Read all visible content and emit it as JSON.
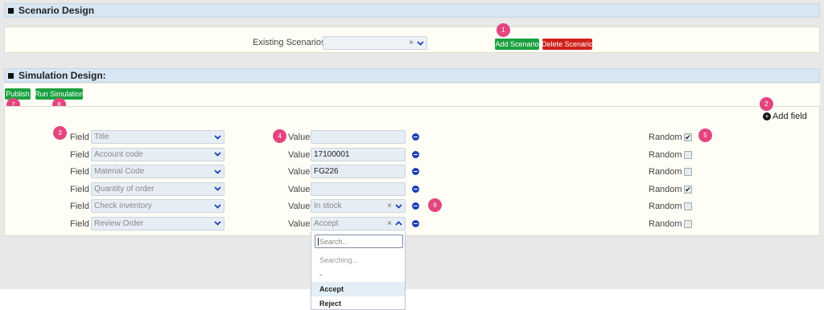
{
  "scenario_design": {
    "title": "Scenario Design",
    "existing_label": "Existing Scenarios",
    "select_value": "",
    "add_button": "Add Scenario",
    "delete_button": "Delete Scenario",
    "badge": "1"
  },
  "simulation_design": {
    "title": "Simulation Design:",
    "publish_button": "Publish",
    "run_button": "Run Simulation",
    "add_field": "Add field",
    "field_label": "Field",
    "value_label": "Value",
    "random_label": "Random",
    "rows": [
      {
        "field": "Title",
        "value": "",
        "value_type": "input",
        "random": true
      },
      {
        "field": "Account code",
        "value": "17100001",
        "value_type": "input",
        "random": false
      },
      {
        "field": "Material Code",
        "value": "FG226",
        "value_type": "input",
        "random": false
      },
      {
        "field": "Quantity of order",
        "value": "",
        "value_type": "input",
        "random": true
      },
      {
        "field": "Check inventory",
        "value": "In stock",
        "value_type": "select",
        "random": false
      },
      {
        "field": "Review Order",
        "value": "Accept",
        "value_type": "select-open",
        "random": false
      }
    ],
    "dropdown": {
      "search_placeholder": "Search...",
      "items": [
        "Searching...",
        "-",
        "Accept",
        "Reject"
      ]
    },
    "badges": [
      "2",
      "3",
      "4",
      "5",
      "6",
      "7",
      "8"
    ]
  }
}
